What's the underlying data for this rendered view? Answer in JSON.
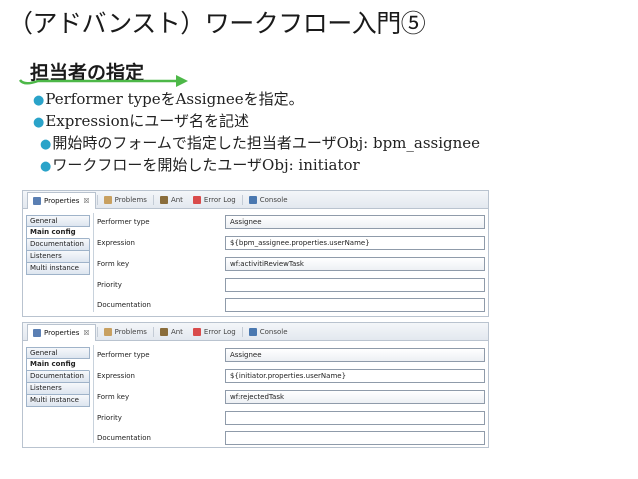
{
  "slide": {
    "title": "（アドバンスト）ワークフロー入門⑤",
    "section": "担当者の指定",
    "bullets": [
      "Performer typeをAssigneeを指定。",
      "Expressionにユーザ名を記述",
      "開始時のフォームで指定した担当者ユーザObj: bpm_assignee",
      "ワークフローを開始したユーザObj: initiator"
    ],
    "bullet_marker": "●",
    "accent_color": "#2aa3c9",
    "arrow_color": "#4db848"
  },
  "panel1": {
    "tabs": [
      {
        "label": "Properties",
        "icon": "properties-icon",
        "close": "☒"
      },
      {
        "label": "Problems",
        "icon": "problems-icon"
      },
      {
        "label": "Ant",
        "icon": "ant-icon"
      },
      {
        "label": "Error Log",
        "icon": "error-log-icon"
      },
      {
        "label": "Console",
        "icon": "console-icon"
      }
    ],
    "sidebar": [
      "General",
      "Main config",
      "Documentation",
      "Listeners",
      "Multi instance"
    ],
    "fields": [
      {
        "label": "Performer type",
        "value": "Assignee"
      },
      {
        "label": "Expression",
        "value": "${bpm_assignee.properties.userName}"
      },
      {
        "label": "Form key",
        "value": "wf:activitiReviewTask"
      },
      {
        "label": "Priority",
        "value": ""
      },
      {
        "label": "Documentation",
        "value": ""
      }
    ]
  },
  "panel2": {
    "tabs": [
      {
        "label": "Properties",
        "icon": "properties-icon",
        "close": "☒"
      },
      {
        "label": "Problems",
        "icon": "problems-icon"
      },
      {
        "label": "Ant",
        "icon": "ant-icon"
      },
      {
        "label": "Error Log",
        "icon": "error-log-icon"
      },
      {
        "label": "Console",
        "icon": "console-icon"
      }
    ],
    "sidebar": [
      "General",
      "Main config",
      "Documentation",
      "Listeners",
      "Multi instance"
    ],
    "fields": [
      {
        "label": "Performer type",
        "value": "Assignee"
      },
      {
        "label": "Expression",
        "value": "${initiator.properties.userName}"
      },
      {
        "label": "Form key",
        "value": "wf:rejectedTask"
      },
      {
        "label": "Priority",
        "value": ""
      },
      {
        "label": "Documentation",
        "value": ""
      }
    ]
  }
}
